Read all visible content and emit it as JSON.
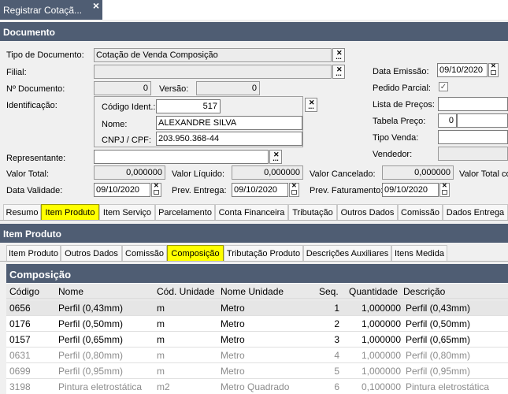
{
  "window": {
    "tab_title": "Registrar Cotaçã...",
    "close_glyph": "×"
  },
  "documento": {
    "header": "Documento",
    "tipo_documento": {
      "label": "Tipo de Documento:",
      "value": "Cotação de Venda Composição"
    },
    "filial": {
      "label": "Filial:",
      "value": ""
    },
    "n_documento": {
      "label": "Nº Documento:",
      "value": "0"
    },
    "versao": {
      "label": "Versão:",
      "value": "0"
    },
    "identificacao": {
      "label": "Identificação:",
      "codigo_ident": {
        "label": "Código Ident.:",
        "value": "517"
      },
      "nome": {
        "label": "Nome:",
        "value": "ALEXANDRE SILVA"
      },
      "cnpj_cpf": {
        "label": "CNPJ / CPF:",
        "value": "203.950.368-44"
      }
    },
    "representante": {
      "label": "Representante:",
      "value": ""
    },
    "data_emissao": {
      "label": "Data Emissão:",
      "value": "09/10/2020"
    },
    "pedido_parcial": {
      "label": "Pedido Parcial:",
      "checked": "✓"
    },
    "lista_precos": {
      "label": "Lista de Preços:",
      "value": ""
    },
    "tabela_preco": {
      "label": "Tabela Preço:",
      "value": "0"
    },
    "tipo_venda": {
      "label": "Tipo Venda:",
      "value": ""
    },
    "vendedor": {
      "label": "Vendedor:",
      "value": ""
    },
    "valor_total": {
      "label": "Valor Total:",
      "value": "0,000000"
    },
    "valor_liquido": {
      "label": "Valor Líquido:",
      "value": "0,000000"
    },
    "valor_cancelado": {
      "label": "Valor Cancelado:",
      "value": "0,000000"
    },
    "valor_total_com": {
      "label": "Valor Total co"
    },
    "data_validade": {
      "label": "Data Validade:",
      "value": "09/10/2020"
    },
    "prev_entrega": {
      "label": "Prev. Entrega:",
      "value": "09/10/2020"
    },
    "prev_faturamento": {
      "label": "Prev. Faturamento:",
      "value": "09/10/2020"
    }
  },
  "main_tabs": [
    "Resumo",
    "Item Produto",
    "Item Serviço",
    "Parcelamento",
    "Conta Financeira",
    "Tributação",
    "Outros Dados",
    "Comissão",
    "Dados Entrega"
  ],
  "item_produto": {
    "header": "Item Produto",
    "tabs": [
      "Item Produto",
      "Outros Dados",
      "Comissão",
      "Composição",
      "Tributação Produto",
      "Descrições Auxiliares",
      "Itens Medida"
    ]
  },
  "composicao": {
    "header": "Composição",
    "columns": [
      "Código",
      "Nome",
      "Cód. Unidade",
      "Nome Unidade",
      "Seq.",
      "Quantidade",
      "Descrição"
    ],
    "rows": [
      {
        "codigo": "0656",
        "nome": "Perfil (0,43mm)",
        "cod_unidade": "m",
        "nome_unidade": "Metro",
        "seq": "1",
        "quantidade": "1,000000",
        "descricao": "Perfil (0,43mm)"
      },
      {
        "codigo": "0176",
        "nome": "Perfil (0,50mm)",
        "cod_unidade": "m",
        "nome_unidade": "Metro",
        "seq": "2",
        "quantidade": "1,000000",
        "descricao": "Perfil (0,50mm)"
      },
      {
        "codigo": "0157",
        "nome": "Perfil (0,65mm)",
        "cod_unidade": "m",
        "nome_unidade": "Metro",
        "seq": "3",
        "quantidade": "1,000000",
        "descricao": "Perfil (0,65mm)"
      },
      {
        "codigo": "0631",
        "nome": "Perfil (0,80mm)",
        "cod_unidade": "m",
        "nome_unidade": "Metro",
        "seq": "4",
        "quantidade": "1,000000",
        "descricao": "Perfil (0,80mm)"
      },
      {
        "codigo": "0699",
        "nome": "Perfil (0,95mm)",
        "cod_unidade": "m",
        "nome_unidade": "Metro",
        "seq": "5",
        "quantidade": "1,000000",
        "descricao": "Perfil (0,95mm)"
      },
      {
        "codigo": "3198",
        "nome": "Pintura eletrostática",
        "cod_unidade": "m2",
        "nome_unidade": "Metro Quadrado",
        "seq": "6",
        "quantidade": "0,100000",
        "descricao": "Pintura eletrostática"
      }
    ]
  },
  "colors": {
    "header_bg": "#4f5d73",
    "selected_tab": "#ffff00"
  }
}
